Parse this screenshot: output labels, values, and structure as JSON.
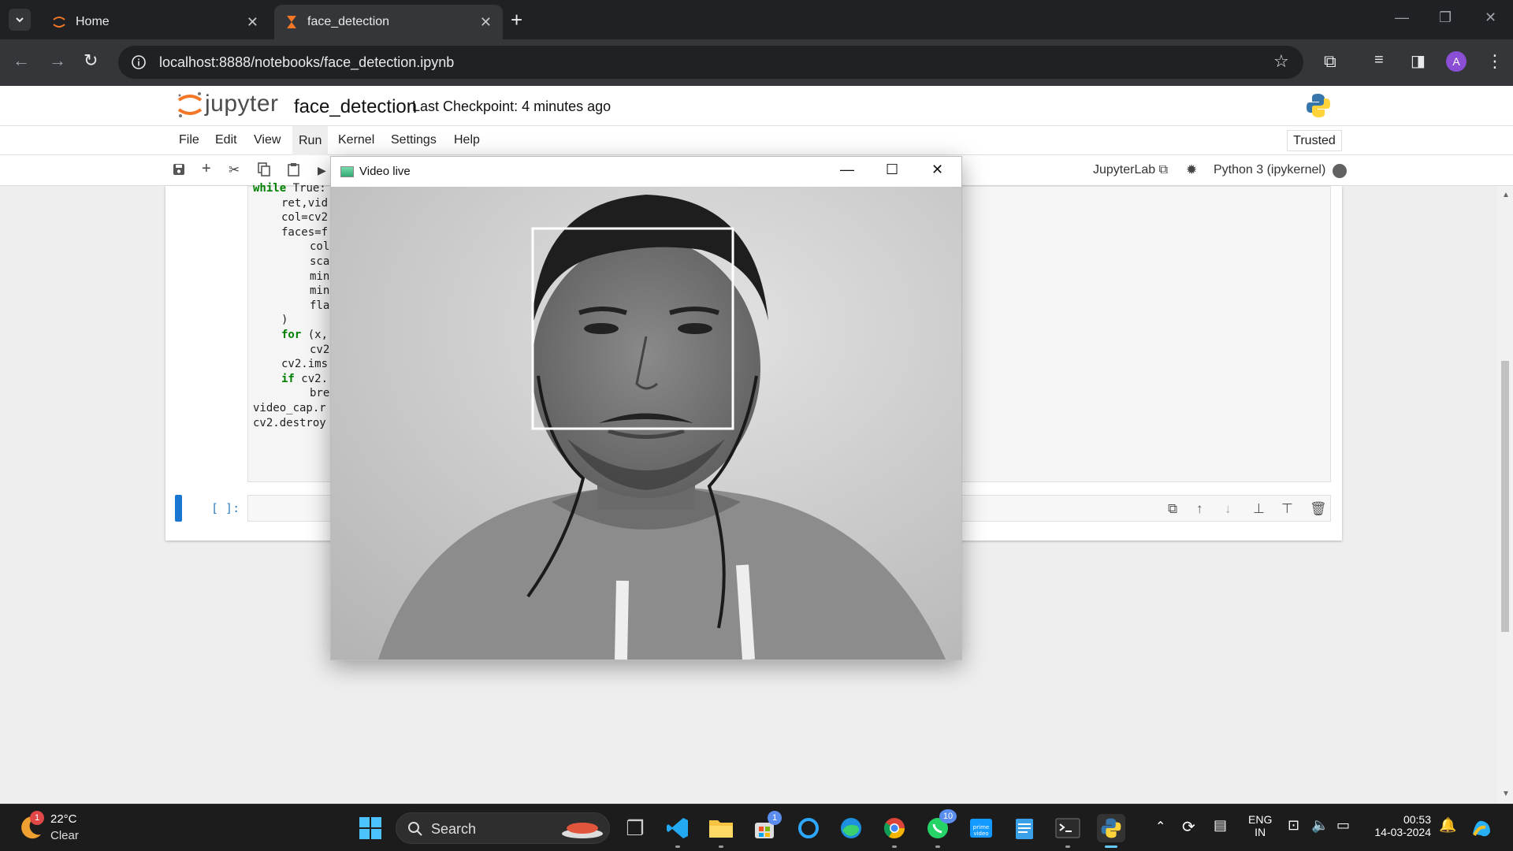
{
  "browser": {
    "tabs": [
      {
        "title": "Home",
        "active": false
      },
      {
        "title": "face_detection",
        "active": true
      }
    ],
    "url": "localhost:8888/notebooks/face_detection.ipynb",
    "profile_initial": "A"
  },
  "jupyter": {
    "brand": "jupyter",
    "notebook_name": "face_detection",
    "checkpoint": "Last Checkpoint: 4 minutes ago",
    "menu": [
      "File",
      "Edit",
      "View",
      "Run",
      "Kernel",
      "Settings",
      "Help"
    ],
    "trusted": "Trusted",
    "jupyterlab_link": "JupyterLab",
    "kernel": "Python 3 (ipykernel)",
    "empty_prompt": "[ ]:",
    "code_lines": [
      {
        "indent": 0,
        "text": "while True:"
      },
      {
        "indent": 1,
        "text": "ret,vid"
      },
      {
        "indent": 1,
        "text": "col=cv2"
      },
      {
        "indent": 1,
        "text": "faces=f"
      },
      {
        "indent": 2,
        "text": "col"
      },
      {
        "indent": 2,
        "text": "sca"
      },
      {
        "indent": 2,
        "text": "min"
      },
      {
        "indent": 2,
        "text": "min"
      },
      {
        "indent": 2,
        "text": "fla"
      },
      {
        "indent": 1,
        "text": ")"
      },
      {
        "indent": 1,
        "text": "for (x,"
      },
      {
        "indent": 2,
        "text": "cv2"
      },
      {
        "indent": 1,
        "text": "cv2.ims"
      },
      {
        "indent": 1,
        "text": "if cv2."
      },
      {
        "indent": 2,
        "text": "bre"
      },
      {
        "indent": 0,
        "text": "video_cap.r"
      },
      {
        "indent": 0,
        "text": "cv2.destroy"
      }
    ]
  },
  "cv_window": {
    "title": "Video live"
  },
  "taskbar": {
    "weather_temp": "22°C",
    "weather_desc": "Clear",
    "weather_badge": "1",
    "search_label": "Search",
    "store_badge": "1",
    "whatsapp_badge": "10",
    "lang_1": "ENG",
    "lang_2": "IN",
    "time": "00:53",
    "date": "14-03-2024"
  },
  "colors": {
    "jupyter_orange": "#f37726",
    "cell_marker": "#1976d2",
    "chrome_dark": "#202124"
  }
}
